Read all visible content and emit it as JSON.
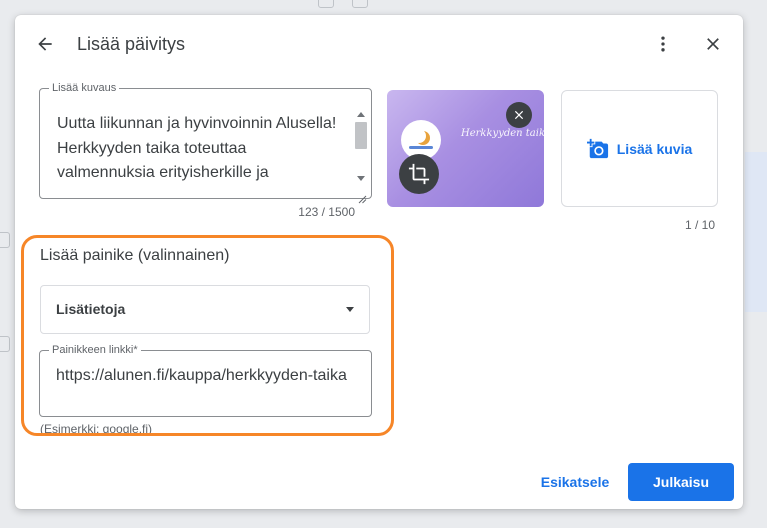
{
  "dialog": {
    "title": "Lisää päivitys",
    "icons": {
      "back": "arrow-back-icon",
      "more": "more-vert-icon",
      "close": "close-icon"
    }
  },
  "description": {
    "label": "Lisää kuvaus",
    "text": "Uutta liikunnan ja hyvinvoinnin Alusella! Herkkyyden taika toteuttaa valmennuksia erityisherkille ja",
    "counter": "123 / 1500"
  },
  "media": {
    "thumbnail_brand": "Herkkyyden taika",
    "remove_icon": "close-icon",
    "crop_icon": "crop-icon",
    "add_photos_label": "Lisää kuvia",
    "add_photos_icon": "add-photo-icon",
    "counter": "1 / 10"
  },
  "cta": {
    "heading": "Lisää painike (valinnainen)",
    "selected": "Lisätietoja",
    "link_label": "Painikkeen linkki*",
    "link_value": "https://alunen.fi/kauppa/herkkyyden-taika",
    "hint": "(Esimerkki: google.fi)"
  },
  "footer": {
    "preview_label": "Esikatsele",
    "publish_label": "Julkaisu"
  },
  "colors": {
    "accent": "#1a73e8",
    "highlight": "#f68628"
  }
}
